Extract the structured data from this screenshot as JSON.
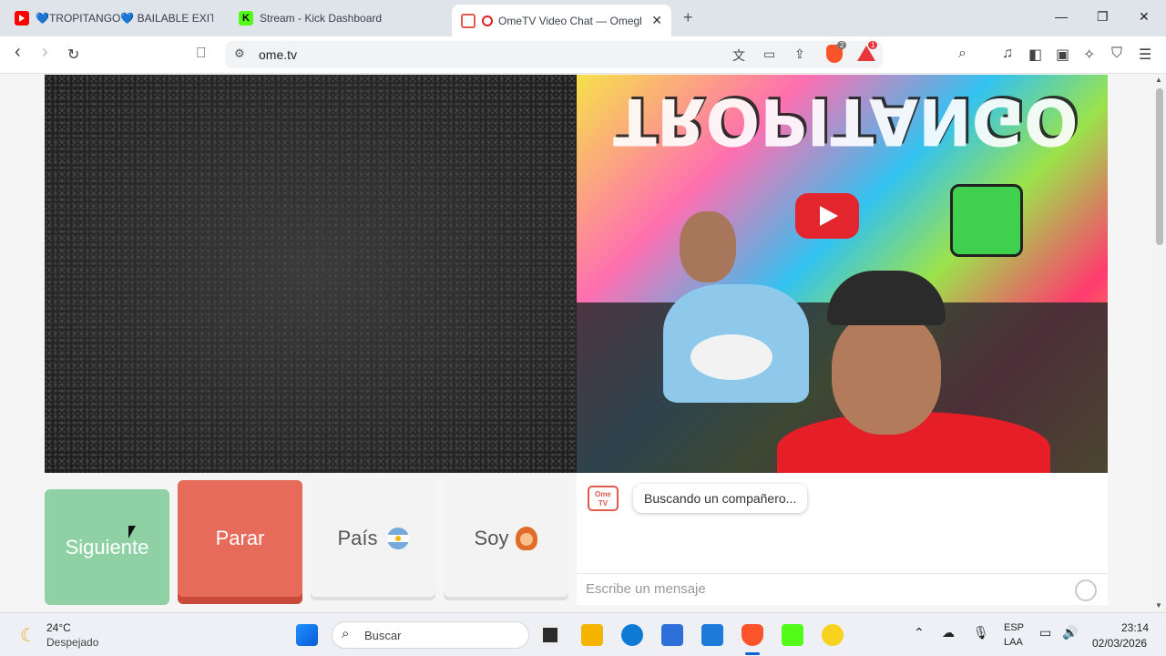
{
  "browser": {
    "tabs": [
      {
        "title": "💙TROPITANGO💙 BAILABLE EXITO",
        "favicon": "youtube-icon",
        "active": false
      },
      {
        "title": "Stream - Kick Dashboard",
        "favicon": "kick-icon",
        "active": false
      },
      {
        "title": "OmeTV Video Chat — Omegl",
        "favicon": "ometv-icon",
        "active": true
      }
    ],
    "url": "ome.tv",
    "extensions": {
      "shields_count": "2",
      "rewards_count": "1"
    },
    "window_controls": {
      "minimize": "—",
      "restore": "❐",
      "close": "✕"
    }
  },
  "page": {
    "buttons": {
      "next": "Siguiente",
      "stop": "Parar",
      "country": "País",
      "gender": "Soy"
    },
    "chat": {
      "status_message": "Buscando un compañero...",
      "input_placeholder": "Escribe un mensaje",
      "logo_text": "Ome TV"
    }
  },
  "taskbar": {
    "weather": {
      "temp": "24°C",
      "condition": "Despejado"
    },
    "search_placeholder": "Buscar",
    "language": {
      "line1": "ESP",
      "line2": "LAA"
    },
    "clock": {
      "time": "23:14",
      "date": "02/03/2026"
    }
  },
  "colors": {
    "next_button": "#8fd1a4",
    "stop_button": "#e66b5a",
    "neutral_button": "#f3f3f3",
    "accent_brave": "#fb542b"
  }
}
